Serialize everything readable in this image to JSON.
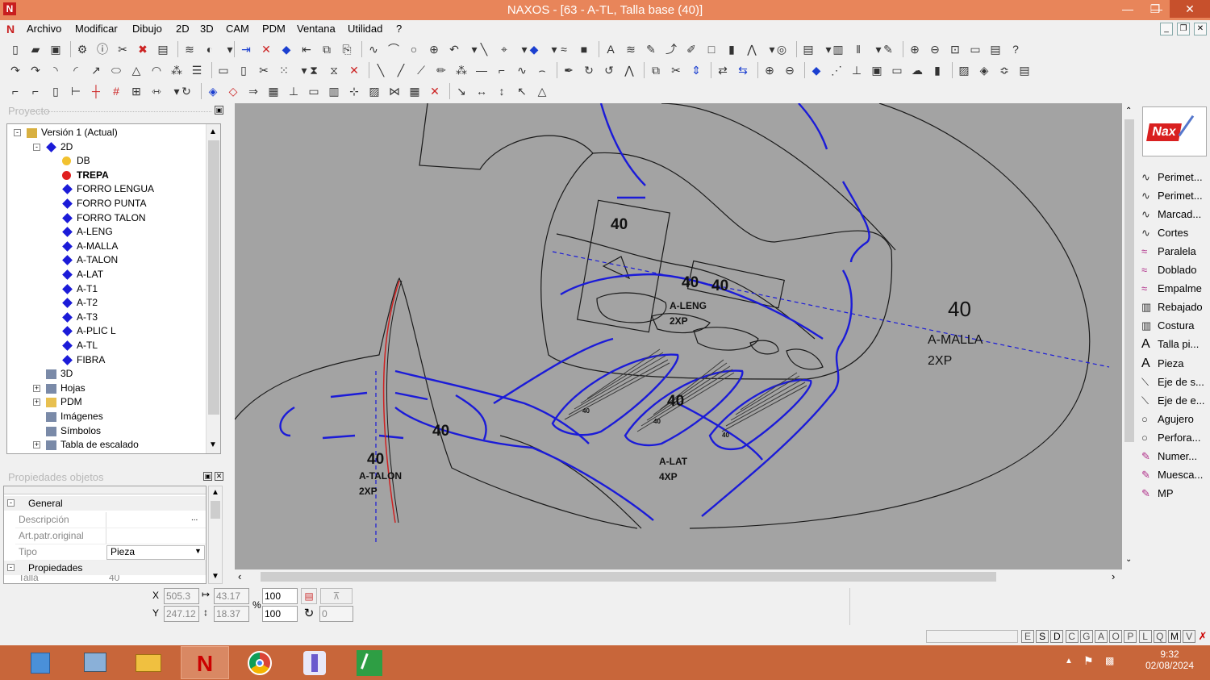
{
  "window": {
    "title": "NAXOS - [63 - A-TL, Talla base (40)]",
    "logo": "N"
  },
  "menu": [
    "Archivo",
    "Modificar",
    "Dibujo",
    "2D",
    "3D",
    "CAM",
    "PDM",
    "Ventana",
    "Utilidad",
    "?"
  ],
  "project": {
    "header": "Proyecto",
    "tree": [
      {
        "label": "Versión 1 (Actual)",
        "icon": "version-icon",
        "level": 0
      },
      {
        "label": "2D",
        "icon": "2d-icon",
        "level": 1
      },
      {
        "label": "DB",
        "icon": "yellow-dot-icon",
        "level": 2
      },
      {
        "label": "TREPA",
        "icon": "red-dot-icon",
        "level": 2,
        "bold": true
      },
      {
        "label": "FORRO LENGUA",
        "icon": "blue-diamond-icon",
        "level": 2
      },
      {
        "label": "FORRO PUNTA",
        "icon": "blue-diamond-icon",
        "level": 2
      },
      {
        "label": "FORRO TALON",
        "icon": "blue-diamond-icon",
        "level": 2
      },
      {
        "label": "A-LENG",
        "icon": "blue-diamond-icon",
        "level": 2
      },
      {
        "label": "A-MALLA",
        "icon": "blue-diamond-icon",
        "level": 2
      },
      {
        "label": "A-TALON",
        "icon": "blue-diamond-icon",
        "level": 2
      },
      {
        "label": "A-LAT",
        "icon": "blue-diamond-icon",
        "level": 2
      },
      {
        "label": "A-T1",
        "icon": "blue-diamond-icon",
        "level": 2
      },
      {
        "label": "A-T2",
        "icon": "blue-diamond-icon",
        "level": 2
      },
      {
        "label": "A-T3",
        "icon": "blue-diamond-icon",
        "level": 2
      },
      {
        "label": "A-PLIC L",
        "icon": "blue-diamond-icon",
        "level": 2
      },
      {
        "label": "A-TL",
        "icon": "blue-diamond-icon",
        "level": 2
      },
      {
        "label": "FIBRA",
        "icon": "blue-diamond-icon",
        "level": 2
      },
      {
        "label": "3D",
        "icon": "3d-icon",
        "level": 1
      },
      {
        "label": "Hojas",
        "icon": "sheets-icon",
        "level": 1
      },
      {
        "label": "PDM",
        "icon": "folder-icon",
        "level": 1
      },
      {
        "label": "Imágenes",
        "icon": "images-icon",
        "level": 1
      },
      {
        "label": "Símbolos",
        "icon": "symbols-icon",
        "level": 1
      },
      {
        "label": "Tabla de escalado",
        "icon": "table-icon",
        "level": 1
      }
    ]
  },
  "properties": {
    "header": "Propiedades objetos",
    "general": "General",
    "rows": [
      {
        "label": "Descripción",
        "value": "",
        "btn": "..."
      },
      {
        "label": "Art.patr.original",
        "value": ""
      },
      {
        "label": "Tipo",
        "value": "Pieza"
      }
    ],
    "section2": "Propiedades",
    "talla_label": "Talla",
    "talla_value": "40"
  },
  "canvas_labels": [
    {
      "text": "40",
      "cls": "big"
    },
    {
      "text": "40",
      "cls": "big"
    },
    {
      "text": "40",
      "cls": "big"
    },
    {
      "text": "A-LENG",
      "cls": "sm"
    },
    {
      "text": "2XP",
      "cls": "sm"
    },
    {
      "text": "40",
      "cls": "huge"
    },
    {
      "text": "A-MALLA",
      "cls": "med"
    },
    {
      "text": "2XP",
      "cls": "med"
    },
    {
      "text": "40",
      "cls": "big"
    },
    {
      "text": "40",
      "cls": "big"
    },
    {
      "text": "A-TALON",
      "cls": "sm"
    },
    {
      "text": "2XP",
      "cls": "sm"
    },
    {
      "text": "40",
      "cls": "big"
    },
    {
      "text": "A-LAT",
      "cls": "sm"
    },
    {
      "text": "4XP",
      "cls": "sm"
    },
    {
      "text": "40",
      "cls": "tiny"
    },
    {
      "text": "40",
      "cls": "tiny"
    },
    {
      "text": "40",
      "cls": "tiny"
    }
  ],
  "right_panel": [
    {
      "label": "Perimet...",
      "icon": "perimeter-icon"
    },
    {
      "label": "Perimet...",
      "icon": "perimeter-icon"
    },
    {
      "label": "Marcad...",
      "icon": "marker-icon"
    },
    {
      "label": "Cortes",
      "icon": "cut-icon"
    },
    {
      "label": "Paralela",
      "icon": "parallel-icon"
    },
    {
      "label": "Doblado",
      "icon": "fold-icon"
    },
    {
      "label": "Empalme",
      "icon": "join-icon"
    },
    {
      "label": "Rebajado",
      "icon": "skive-icon"
    },
    {
      "label": "Costura",
      "icon": "seam-icon"
    },
    {
      "label": "Talla pi...",
      "icon": "text-icon"
    },
    {
      "label": "Pieza",
      "icon": "text-icon"
    },
    {
      "label": "Eje de s...",
      "icon": "axis-icon"
    },
    {
      "label": "Eje de e...",
      "icon": "axis-icon"
    },
    {
      "label": "Agujero",
      "icon": "hole-icon"
    },
    {
      "label": "Perfora...",
      "icon": "hole-icon"
    },
    {
      "label": "Numer...",
      "icon": "number-icon"
    },
    {
      "label": "Muesca...",
      "icon": "notch-icon"
    },
    {
      "label": "MP",
      "icon": "mp-icon"
    }
  ],
  "coords": {
    "x_label": "X",
    "y_label": "Y",
    "x": "505.3",
    "y": "247.12",
    "dx": "43.17",
    "dy": "18.37",
    "sx": "100",
    "sy": "100",
    "pct": "%",
    "angle": "0"
  },
  "status_letters": [
    "E",
    "S",
    "D",
    "C",
    "G",
    "A",
    "O",
    "P",
    "L",
    "Q",
    "M",
    "V"
  ],
  "clock": {
    "time": "9:32",
    "date": "02/08/2024"
  },
  "accent": {
    "titlebar": "#e8855a",
    "taskbar": "#c8663a",
    "canvas": "#a3a3a3",
    "blue_lines": "#1b1bd8",
    "red_line": "#d02020"
  }
}
